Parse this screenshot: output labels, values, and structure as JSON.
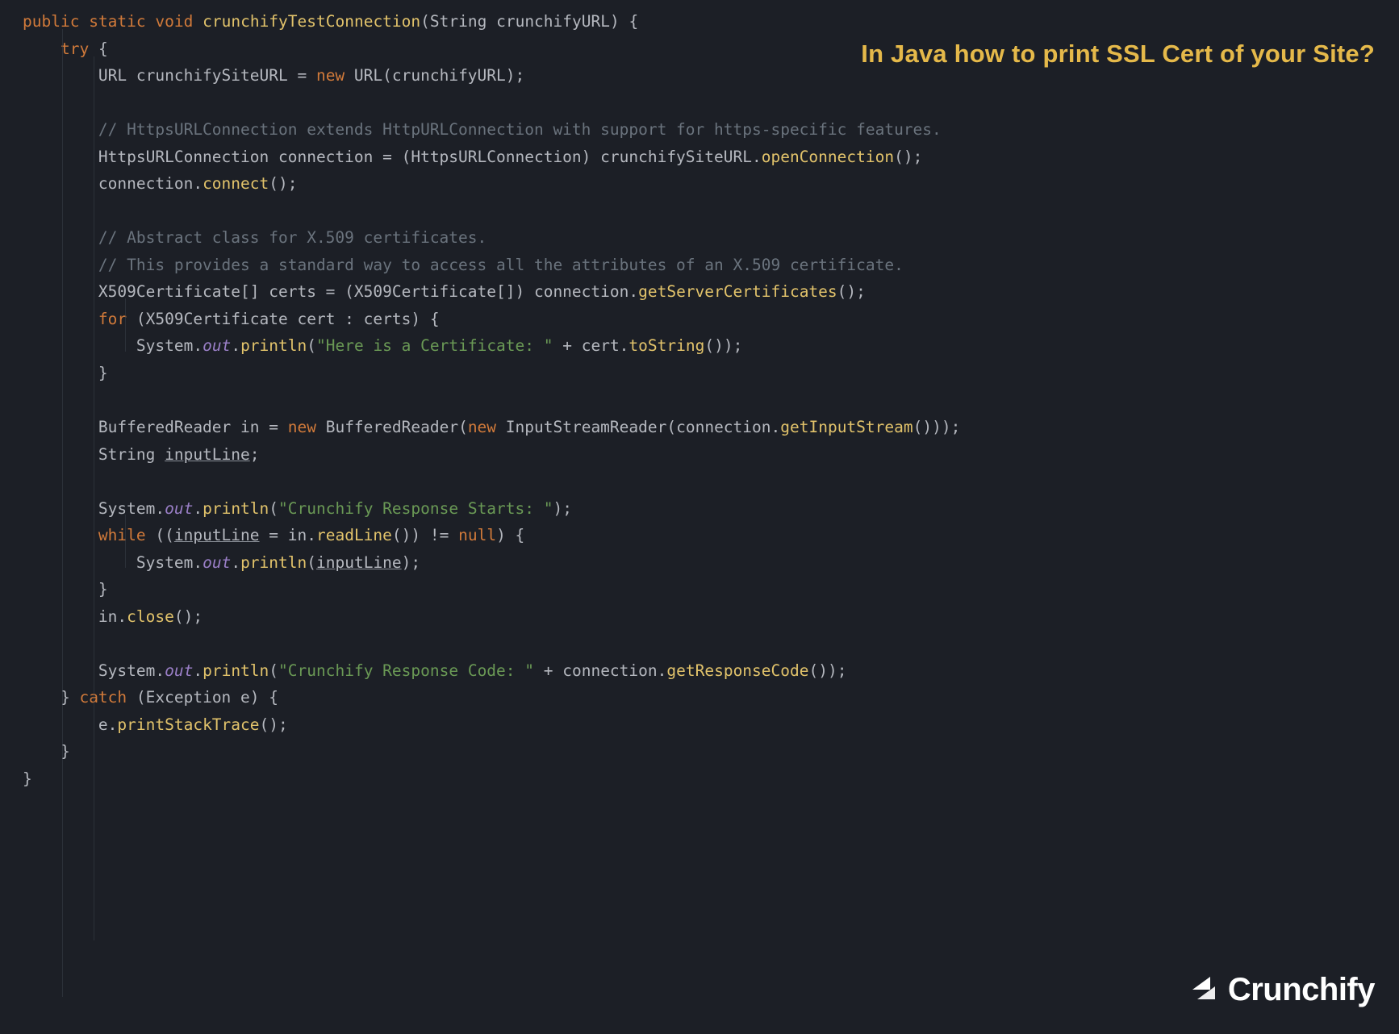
{
  "headline": "In Java how to print SSL Cert of your Site?",
  "brand": "Crunchify",
  "code": {
    "l1_kw1": "public",
    "l1_kw2": "static",
    "l1_kw3": "void",
    "l1_fn": "crunchifyTestConnection",
    "l1_paren_open": "(",
    "l1_type": "String",
    "l1_param": " crunchifyURL",
    "l1_paren_close": ")",
    "l1_brace": " {",
    "l2_kw": "try",
    "l2_brace": " {",
    "l3_a": "URL crunchifySiteURL = ",
    "l3_kw": "new",
    "l3_b": " URL(crunchifyURL);",
    "l5_comment": "// HttpsURLConnection extends HttpURLConnection with support for https-specific features.",
    "l6_a": "HttpsURLConnection connection = (HttpsURLConnection) crunchifySiteURL.",
    "l6_m": "openConnection",
    "l6_b": "();",
    "l7_a": "connection.",
    "l7_m": "connect",
    "l7_b": "();",
    "l9_comment": "// Abstract class for X.509 certificates.",
    "l10_comment": "// This provides a standard way to access all the attributes of an X.509 certificate.",
    "l11_a": "X509Certificate[] certs = (X509Certificate[]) connection.",
    "l11_m": "getServerCertificates",
    "l11_b": "();",
    "l12_kw": "for",
    "l12_body": " (X509Certificate cert : certs) {",
    "l13_a": "System.",
    "l13_out": "out",
    "l13_b": ".",
    "l13_m": "println",
    "l13_c": "(",
    "l13_str": "\"Here is a Certificate: \"",
    "l13_d": " + cert.",
    "l13_m2": "toString",
    "l13_e": "());",
    "l14": "}",
    "l16_a": "BufferedReader in = ",
    "l16_kw1": "new",
    "l16_b": " BufferedReader(",
    "l16_kw2": "new",
    "l16_c": " InputStreamReader(connection.",
    "l16_m": "getInputStream",
    "l16_d": "()));",
    "l17_a": "String ",
    "l17_var": "inputLine",
    "l17_b": ";",
    "l19_a": "System.",
    "l19_out": "out",
    "l19_b": ".",
    "l19_m": "println",
    "l19_c": "(",
    "l19_str": "\"Crunchify Response Starts: \"",
    "l19_d": ");",
    "l20_kw": "while",
    "l20_a": " ((",
    "l20_var": "inputLine",
    "l20_b": " = in.",
    "l20_m": "readLine",
    "l20_c": "()) != ",
    "l20_null": "null",
    "l20_d": ") {",
    "l21_a": "System.",
    "l21_out": "out",
    "l21_b": ".",
    "l21_m": "println",
    "l21_c": "(",
    "l21_var": "inputLine",
    "l21_d": ");",
    "l22": "}",
    "l23_a": "in.",
    "l23_m": "close",
    "l23_b": "();",
    "l25_a": "System.",
    "l25_out": "out",
    "l25_b": ".",
    "l25_m": "println",
    "l25_c": "(",
    "l25_str": "\"Crunchify Response Code: \"",
    "l25_d": " + connection.",
    "l25_m2": "getResponseCode",
    "l25_e": "());",
    "l26_a": "} ",
    "l26_kw": "catch",
    "l26_b": " (Exception e) {",
    "l27_a": "e.",
    "l27_m": "printStackTrace",
    "l27_b": "();",
    "l28": "}",
    "l29": "}"
  }
}
